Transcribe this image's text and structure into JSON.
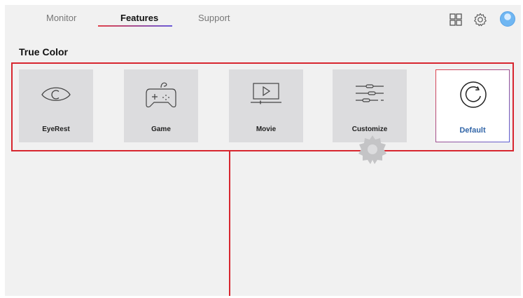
{
  "nav": {
    "tabs": [
      {
        "label": "Monitor",
        "active": false
      },
      {
        "label": "Features",
        "active": true
      },
      {
        "label": "Support",
        "active": false
      }
    ],
    "icons": [
      "grid-icon",
      "settings-gear-icon",
      "user-avatar-icon"
    ]
  },
  "section": {
    "title": "True Color"
  },
  "tiles": [
    {
      "label": "EyeRest",
      "icon": "eye-icon"
    },
    {
      "label": "Game",
      "icon": "gamepad-icon"
    },
    {
      "label": "Movie",
      "icon": "movie-icon"
    },
    {
      "label": "Customize",
      "icon": "sliders-icon",
      "extra_icon": "gear-icon"
    },
    {
      "label": "Default",
      "icon": "reset-icon",
      "selected": true
    }
  ],
  "colors": {
    "highlight": "#d7262f",
    "selected_label": "#3266a8",
    "tile_bg": "#dcdcde",
    "page_bg": "#f1f1f1"
  }
}
